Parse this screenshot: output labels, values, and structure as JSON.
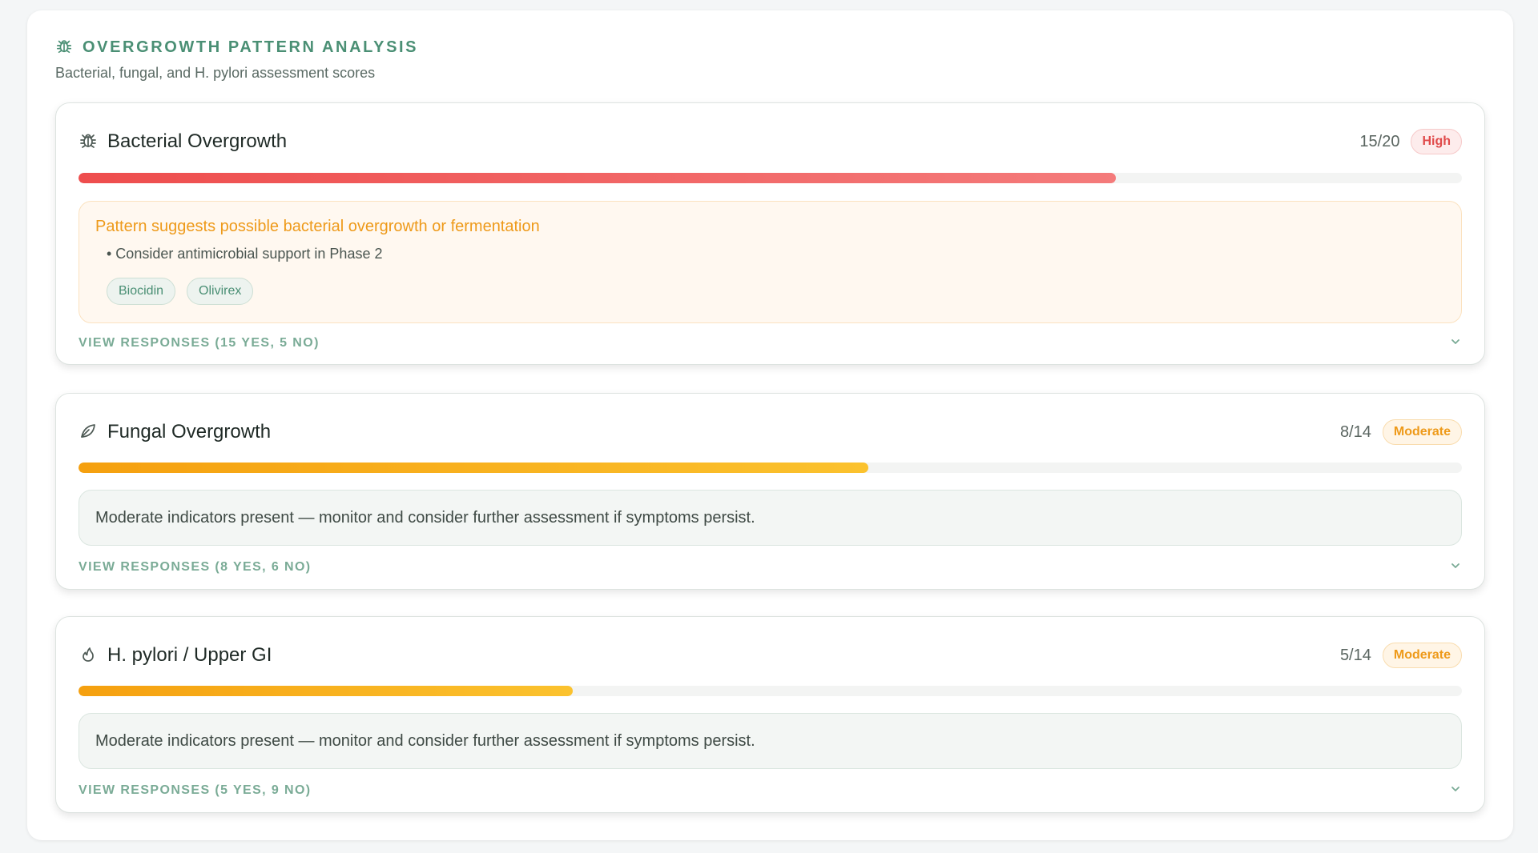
{
  "panel": {
    "title": "OVERGROWTH PATTERN ANALYSIS",
    "subtitle": "Bacterial, fungal, and H. pylori assessment scores",
    "title_icon": "bug-icon"
  },
  "colors": {
    "accent_green": "#4a8f74",
    "high_red": "#e04a4a",
    "moderate_amber": "#ee9a1a"
  },
  "cards": [
    {
      "icon": "bug-icon",
      "title": "Bacterial Overgrowth",
      "score": "15/20",
      "severity": "High",
      "progress_fraction": 0.75,
      "alert_title": "Pattern suggests possible bacterial overgrowth or fermentation",
      "alert_bullet": "• Consider antimicrobial support in Phase 2",
      "chips": [
        "Biocidin",
        "Olivirex"
      ],
      "responses_label": "VIEW RESPONSES (15 YES, 5 NO)"
    },
    {
      "icon": "leaf-icon",
      "title": "Fungal Overgrowth",
      "score": "8/14",
      "severity": "Moderate",
      "progress_fraction": 0.571,
      "note": "Moderate indicators present — monitor and consider further assessment if symptoms persist.",
      "responses_label": "VIEW RESPONSES (8 YES, 6 NO)"
    },
    {
      "icon": "flame-icon",
      "title": "H. pylori / Upper GI",
      "score": "5/14",
      "severity": "Moderate",
      "progress_fraction": 0.357,
      "note": "Moderate indicators present — monitor and consider further assessment if symptoms persist.",
      "responses_label": "VIEW RESPONSES (5 YES, 9 NO)"
    }
  ]
}
